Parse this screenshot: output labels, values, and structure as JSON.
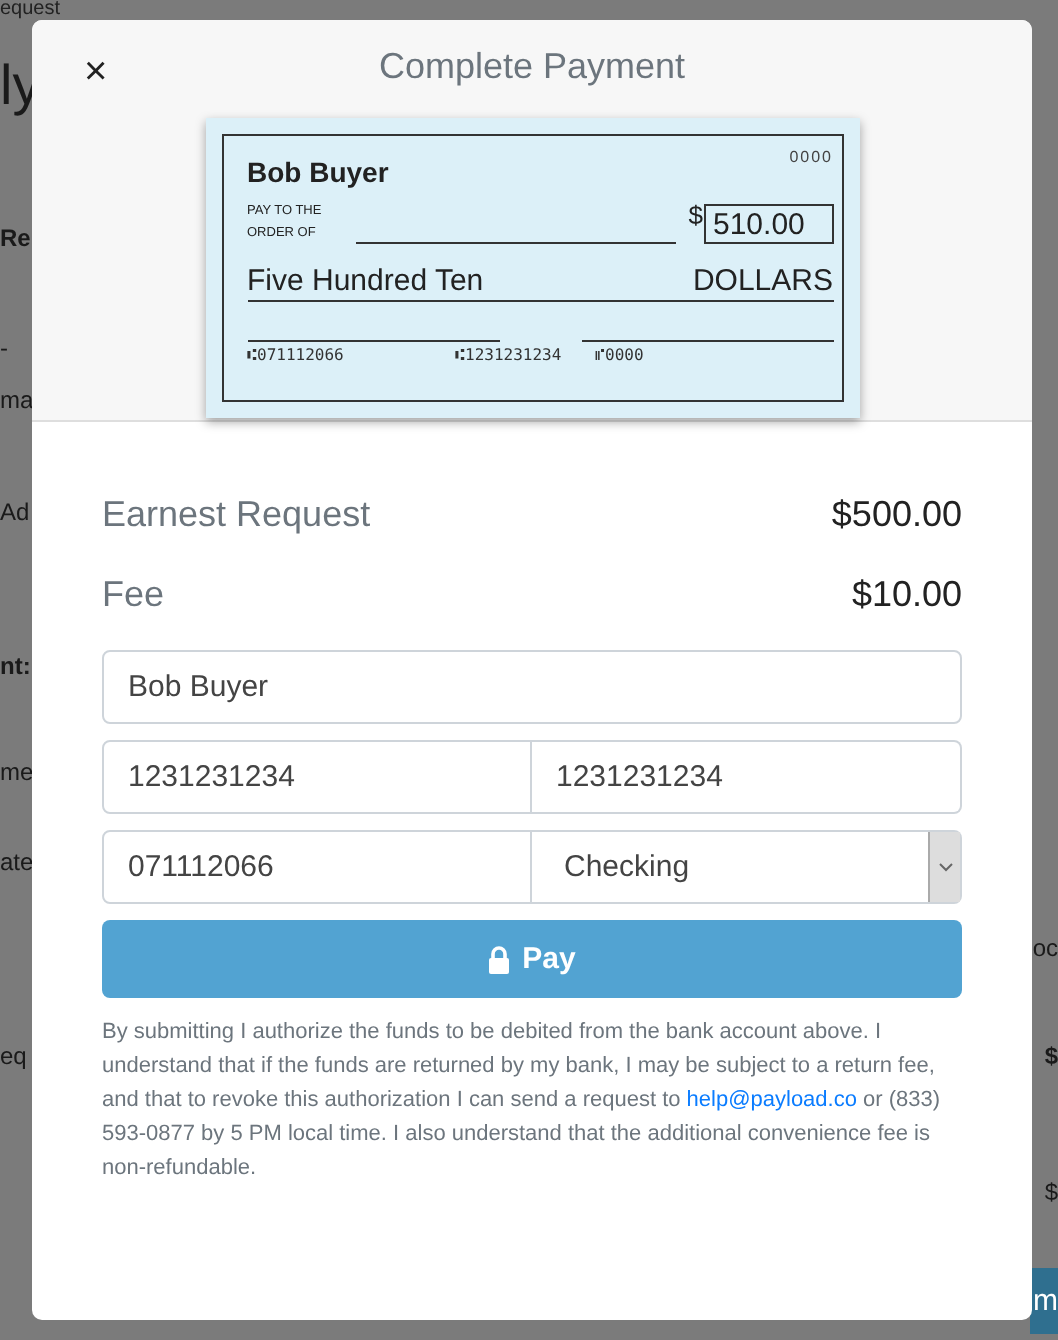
{
  "background": {
    "title": "equest",
    "rows": [
      {
        "left": "ly",
        "right": ""
      },
      {
        "left": "Re",
        "right": ""
      },
      {
        "left": "-",
        "right": ""
      },
      {
        "left": "ma",
        "right": ""
      },
      {
        "left": "Ad",
        "right": ""
      },
      {
        "left": "nt:",
        "right": ""
      },
      {
        "left": "me",
        "right": ""
      },
      {
        "left": "ate",
        "right": ""
      },
      {
        "left": "",
        "right": "oc"
      },
      {
        "left": "eq",
        "right": "$"
      },
      {
        "left": "",
        "right": "$"
      },
      {
        "left": "",
        "right": "m"
      }
    ]
  },
  "modal": {
    "close": "×",
    "title": "Complete Payment",
    "check": {
      "name": "Bob Buyer",
      "number": "0000",
      "pay_to": "PAY TO THE ORDER OF",
      "currency": "$",
      "amount": "510.00",
      "amount_words": "Five Hundred Ten",
      "dollars": "DOLLARS",
      "micr": [
        "⑆071112066",
        "⑆1231231234",
        "⑈0000"
      ]
    },
    "summary": [
      {
        "label": "Earnest Request",
        "amount": "$500.00"
      },
      {
        "label": "Fee",
        "amount": "$10.00"
      }
    ],
    "form": {
      "name": {
        "value": "Bob Buyer"
      },
      "account_number": {
        "value": "1231231234"
      },
      "confirm_account_number": {
        "value": "1231231234"
      },
      "routing_number": {
        "value": "071112066"
      },
      "account_type": {
        "value": "Checking"
      }
    },
    "pay_button": "Pay",
    "disclaimer": {
      "before": "By submitting I authorize the funds to be debited from the bank account above. I understand that if the funds are returned by my bank, I may be subject to a return fee, and that to revoke this authorization I can send a request to",
      "link": "help@payload.co",
      "after": "or (833) 593-0877 by 5 PM local time. I also understand that the additional convenience fee is non-refundable."
    }
  }
}
